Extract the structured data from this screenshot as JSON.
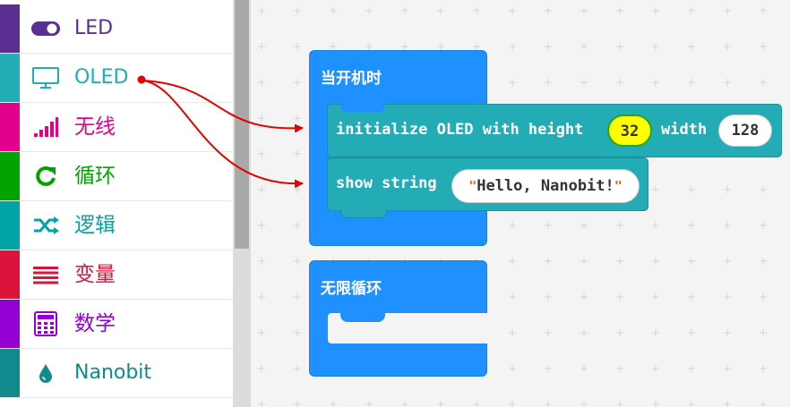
{
  "toolbox": {
    "categories": [
      {
        "label": "LED",
        "color": "#5b2e91",
        "icon": "toggle-icon"
      },
      {
        "label": "OLED",
        "color": "#24acb6",
        "icon": "monitor-icon"
      },
      {
        "label": "无线",
        "color": "#e3008c",
        "icon": "signal-bars-icon"
      },
      {
        "label": "循环",
        "color": "#00a300",
        "icon": "refresh-icon"
      },
      {
        "label": "逻辑",
        "color": "#00a4a6",
        "icon": "shuffle-icon"
      },
      {
        "label": "变量",
        "color": "#dc143c",
        "icon": "list-lines-icon"
      },
      {
        "label": "数学",
        "color": "#9400d3",
        "icon": "calculator-icon"
      },
      {
        "label": "Nanobit",
        "color": "#0f8b8d",
        "icon": "drop-icon"
      }
    ]
  },
  "workspace": {
    "on_start": {
      "title": "当开机时",
      "blocks": [
        {
          "text_a": "initialize OLED with height",
          "height_value": "32",
          "text_b": "width",
          "width_value": "128"
        },
        {
          "text_a": "show string",
          "string_value": "Hello, Nanobit!"
        }
      ]
    },
    "forever": {
      "title": "无限循环"
    }
  },
  "colors": {
    "event_block": "#1e90ff",
    "oled_block": "#24acb6",
    "annotation_arrow": "#e60000"
  }
}
